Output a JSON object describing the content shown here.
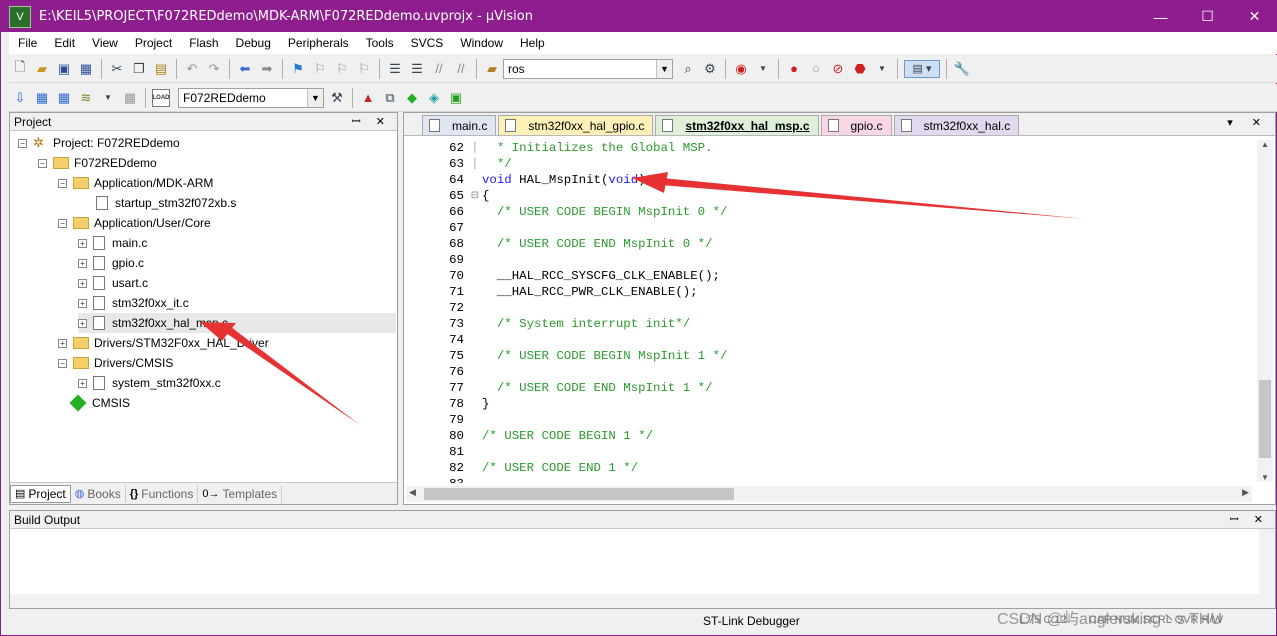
{
  "window": {
    "title": "E:\\KEIL5\\PROJECT\\F072REDdemo\\MDK-ARM\\F072REDdemo.uvprojx - µVision",
    "app_icon": "V",
    "controls": [
      "—",
      "☐",
      "✕"
    ]
  },
  "menu": [
    "File",
    "Edit",
    "View",
    "Project",
    "Flash",
    "Debug",
    "Peripherals",
    "Tools",
    "SVCS",
    "Window",
    "Help"
  ],
  "toolbar": {
    "find_combo_value": "ros",
    "target_combo_value": "F072REDdemo",
    "target_small_icon": "LOAD"
  },
  "project_panel": {
    "title": "Project",
    "pin_controls": "ꟷ ✕",
    "tree": [
      {
        "label": "Project: F072REDdemo",
        "kind": "project"
      },
      {
        "label": "F072REDdemo",
        "kind": "target"
      },
      {
        "label": "Application/MDK-ARM",
        "kind": "folder"
      },
      {
        "label": "startup_stm32f072xb.s",
        "kind": "file"
      },
      {
        "label": "Application/User/Core",
        "kind": "folder"
      },
      {
        "label": "main.c",
        "kind": "file"
      },
      {
        "label": "gpio.c",
        "kind": "file"
      },
      {
        "label": "usart.c",
        "kind": "file"
      },
      {
        "label": "stm32f0xx_it.c",
        "kind": "file"
      },
      {
        "label": "stm32f0xx_hal_msp.c",
        "kind": "file"
      },
      {
        "label": "Drivers/STM32F0xx_HAL_Driver",
        "kind": "folder"
      },
      {
        "label": "Drivers/CMSIS",
        "kind": "folder"
      },
      {
        "label": "system_stm32f0xx.c",
        "kind": "file"
      },
      {
        "label": "CMSIS",
        "kind": "component"
      }
    ],
    "tabs": [
      {
        "label": "Project",
        "icon": "▤"
      },
      {
        "label": "Books",
        "icon": "◍"
      },
      {
        "label": "Functions",
        "icon": "{}"
      },
      {
        "label": "Templates",
        "icon": "0→"
      }
    ]
  },
  "editor": {
    "tabs": [
      "main.c",
      "stm32f0xx_hal_gpio.c",
      "stm32f0xx_hal_msp.c",
      "gpio.c",
      "stm32f0xx_hal.c"
    ],
    "active_tab": "stm32f0xx_hal_msp.c",
    "tab_controls": "▾ ✕",
    "lines": [
      {
        "n": "62",
        "text": "  * Initializes the Global MSP."
      },
      {
        "n": "63",
        "text": "  */"
      },
      {
        "n": "64",
        "text": "void HAL_MspInit(void)"
      },
      {
        "n": "65",
        "text": "{"
      },
      {
        "n": "66",
        "text": "  /* USER CODE BEGIN MspInit 0 */"
      },
      {
        "n": "67",
        "text": ""
      },
      {
        "n": "68",
        "text": "  /* USER CODE END MspInit 0 */"
      },
      {
        "n": "69",
        "text": ""
      },
      {
        "n": "70",
        "text": "  __HAL_RCC_SYSCFG_CLK_ENABLE();"
      },
      {
        "n": "71",
        "text": "  __HAL_RCC_PWR_CLK_ENABLE();"
      },
      {
        "n": "72",
        "text": ""
      },
      {
        "n": "73",
        "text": "  /* System interrupt init*/"
      },
      {
        "n": "74",
        "text": ""
      },
      {
        "n": "75",
        "text": "  /* USER CODE BEGIN MspInit 1 */"
      },
      {
        "n": "76",
        "text": ""
      },
      {
        "n": "77",
        "text": "  /* USER CODE END MspInit 1 */"
      },
      {
        "n": "78",
        "text": "}"
      },
      {
        "n": "79",
        "text": ""
      },
      {
        "n": "80",
        "text": "/* USER CODE BEGIN 1 */"
      },
      {
        "n": "81",
        "text": ""
      },
      {
        "n": "82",
        "text": "/* USER CODE END 1 */"
      },
      {
        "n": "83",
        "text": ""
      }
    ]
  },
  "build_output": {
    "title": "Build Output"
  },
  "statusbar": {
    "debugger": "ST-Link Debugger",
    "position": "L:75 C:12",
    "caps": "CAP NUM SCRL OVR R/W",
    "watermark": "CSDN @屿anglersking丶s THU"
  },
  "colors": {
    "titlebar": "#8e1e8e",
    "comment": "#2a9a2a",
    "keyword": "#1a1aff",
    "annotation_arrow": "#e63232"
  }
}
